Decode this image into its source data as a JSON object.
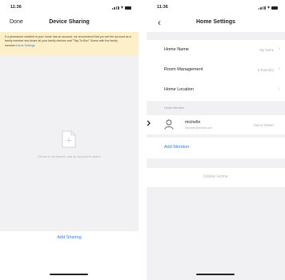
{
  "left_screen": {
    "status": {
      "time": "11:36"
    },
    "nav": {
      "done": "Done",
      "title": "Device Sharing"
    },
    "banner": {
      "text": "If a permanent resident in your home has an account, we recommend that you set the account as a family member and share all your family devices and \"Tap-To-Run\" Scene with the family member.",
      "link": "Home Settings"
    },
    "empty_state": {
      "text": "Device is not shared, add an account to share!"
    },
    "add_sharing": "Add Sharing"
  },
  "right_screen": {
    "status": {
      "time": "11:36"
    },
    "nav": {
      "title": "Home Settings"
    },
    "rows": [
      {
        "label": "Home Name",
        "value": "My home"
      },
      {
        "label": "Room Management",
        "value": "6 Room(s)"
      },
      {
        "label": "Home Location",
        "value": ""
      }
    ],
    "section_header": "Home Member",
    "member": {
      "name": "michelle",
      "email": "michelle@media.com",
      "role": "Home Owner"
    },
    "add_member": "Add Member",
    "delete_home": "Delete Home"
  },
  "colors": {
    "accent": "#2f7de1",
    "banner_bg": "#fdf0c8",
    "grey_bg": "#f1f1f3"
  },
  "icons": [
    "signal-icon",
    "wifi-icon",
    "battery-icon",
    "back-chevron-icon",
    "chevron-right-icon",
    "user-avatar-icon",
    "add-document-icon"
  ]
}
